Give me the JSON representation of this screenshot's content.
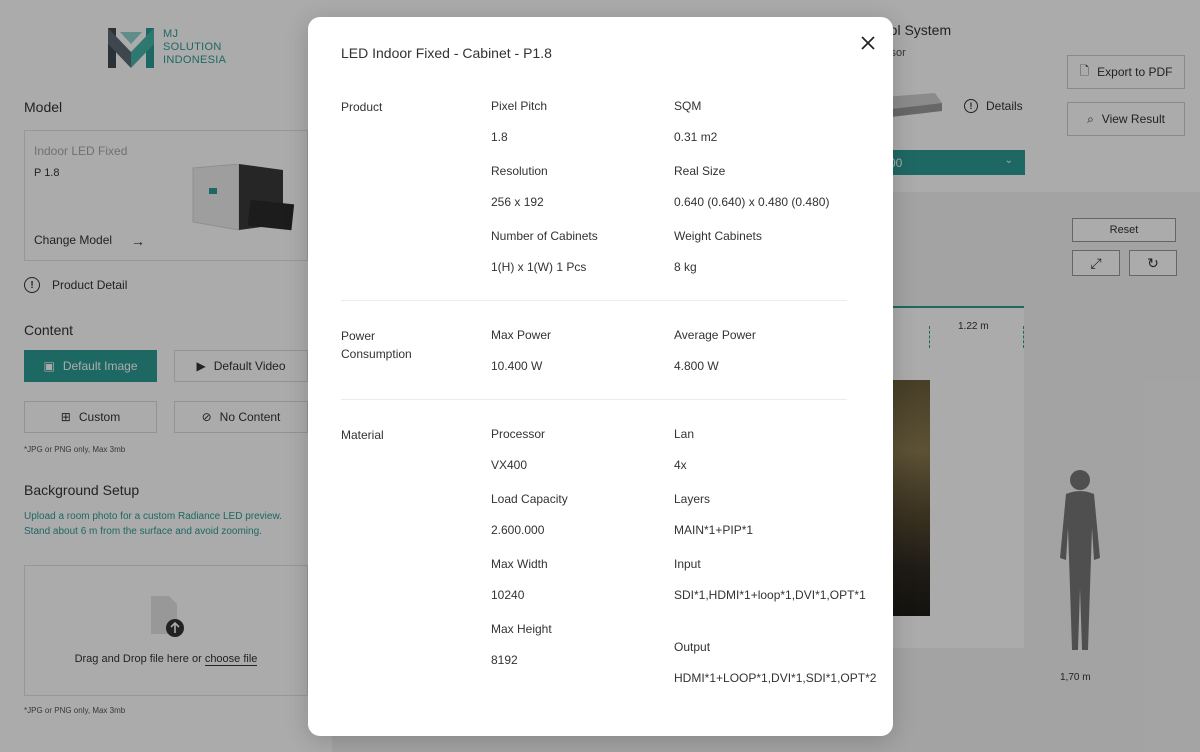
{
  "brand": {
    "line1": "MJ",
    "line2": "SOLUTION",
    "line3": "INDONESIA",
    "color": "#2d9c94"
  },
  "sidebar": {
    "model_title": "Model",
    "model_type": "Indoor LED Fixed",
    "model_name": "P 1.8",
    "change_model": "Change Model",
    "product_detail": "Product Detail",
    "content_title": "Content",
    "default_image": "Default Image",
    "default_video": "Default Video",
    "custom": "Custom",
    "no_content": "No Content",
    "content_note": "*JPG or PNG only, Max 3mb",
    "bg_title": "Background Setup",
    "bg_desc": "Upload a room photo for a custom Radiance LED preview. Stand about 6 m from the surface and avoid zooming.",
    "drop_text_before": "Drag and Drop file here or ",
    "drop_link": "choose file",
    "bg_note": "*JPG or PNG only, Max 3mb"
  },
  "main": {
    "control_title": "rol System",
    "control_sub": "ssor",
    "details": "Details",
    "select_value": "00",
    "export_pdf": "Export to PDF",
    "view_result": "View Result",
    "reset": "Reset",
    "width_label": "1.22 m",
    "height_label": "1,70 m"
  },
  "modal": {
    "title": "LED Indoor Fixed - Cabinet -  P1.8",
    "sections": {
      "product": {
        "label": "Product",
        "pixel_pitch_label": "Pixel Pitch",
        "pixel_pitch_value": "1.8",
        "sqm_label": "SQM",
        "sqm_value": "0.31 m2",
        "resolution_label": "Resolution",
        "resolution_value": "256 x 192",
        "real_size_label": "Real Size",
        "real_size_value": "0.640 (0.640) x 0.480 (0.480)",
        "cabinets_label": "Number of Cabinets",
        "cabinets_value": "1(H) x 1(W) 1 Pcs",
        "weight_label": "Weight Cabinets",
        "weight_value": "8 kg"
      },
      "power": {
        "label": "Power Consumption",
        "max_power_label": "Max Power",
        "max_power_value": "10.400 W",
        "avg_power_label": "Average Power",
        "avg_power_value": "4.800 W"
      },
      "material": {
        "label": "Material",
        "processor_label": "Processor",
        "processor_value": "VX400",
        "lan_label": "Lan",
        "lan_value": "4x",
        "load_label": "Load Capacity",
        "load_value": "2.600.000",
        "layers_label": "Layers",
        "layers_value": "MAIN*1+PIP*1",
        "max_width_label": "Max Width",
        "max_width_value": "10240",
        "input_label": "Input",
        "input_value": "SDI*1,HDMI*1+loop*1,DVI*1,OPT*1",
        "max_height_label": "Max Height",
        "max_height_value": "8192",
        "output_label": "Output",
        "output_value": "HDMI*1+LOOP*1,DVI*1,SDI*1,OPT*2"
      }
    }
  }
}
